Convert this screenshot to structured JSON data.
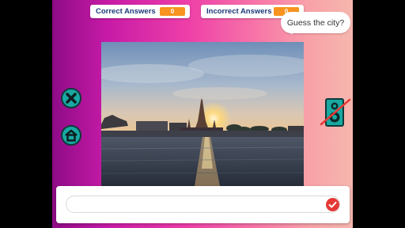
{
  "scoreboard": {
    "correct_label": "Correct Answers",
    "correct_value": "0",
    "incorrect_label": "Incorrect Answers",
    "incorrect_value": "0"
  },
  "prompt": {
    "text": "Guess the city?"
  },
  "answer": {
    "value": "",
    "placeholder": ""
  },
  "icons": {
    "close": "close-icon",
    "home": "home-icon",
    "sound": "speaker-muted-icon",
    "submit": "checkmark-icon"
  },
  "colors": {
    "score_badge": "#f7931e",
    "score_label": "#1d3a7a",
    "button_teal": "#19a8a2",
    "submit_red": "#e53935"
  }
}
